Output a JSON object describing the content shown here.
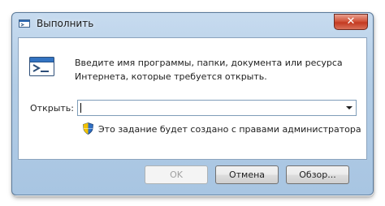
{
  "window": {
    "title": "Выполнить",
    "close_glyph": "✕"
  },
  "content": {
    "description": "Введите имя программы, папки, документа или ресурса Интернета, которые требуется открыть.",
    "open_label": "Открыть:",
    "open_value": "",
    "admin_note": "Это задание будет создано с правами администратора"
  },
  "buttons": {
    "ok": "OK",
    "cancel": "Отмена",
    "browse": "Обзор..."
  },
  "icons": {
    "title": "run-window-icon",
    "main": "run-program-icon",
    "shield": "uac-shield-icon",
    "dropdown": "chevron-down-icon"
  },
  "colors": {
    "frame": "#b3cde6",
    "close_button": "#c43a21",
    "panel": "#ffffff"
  }
}
